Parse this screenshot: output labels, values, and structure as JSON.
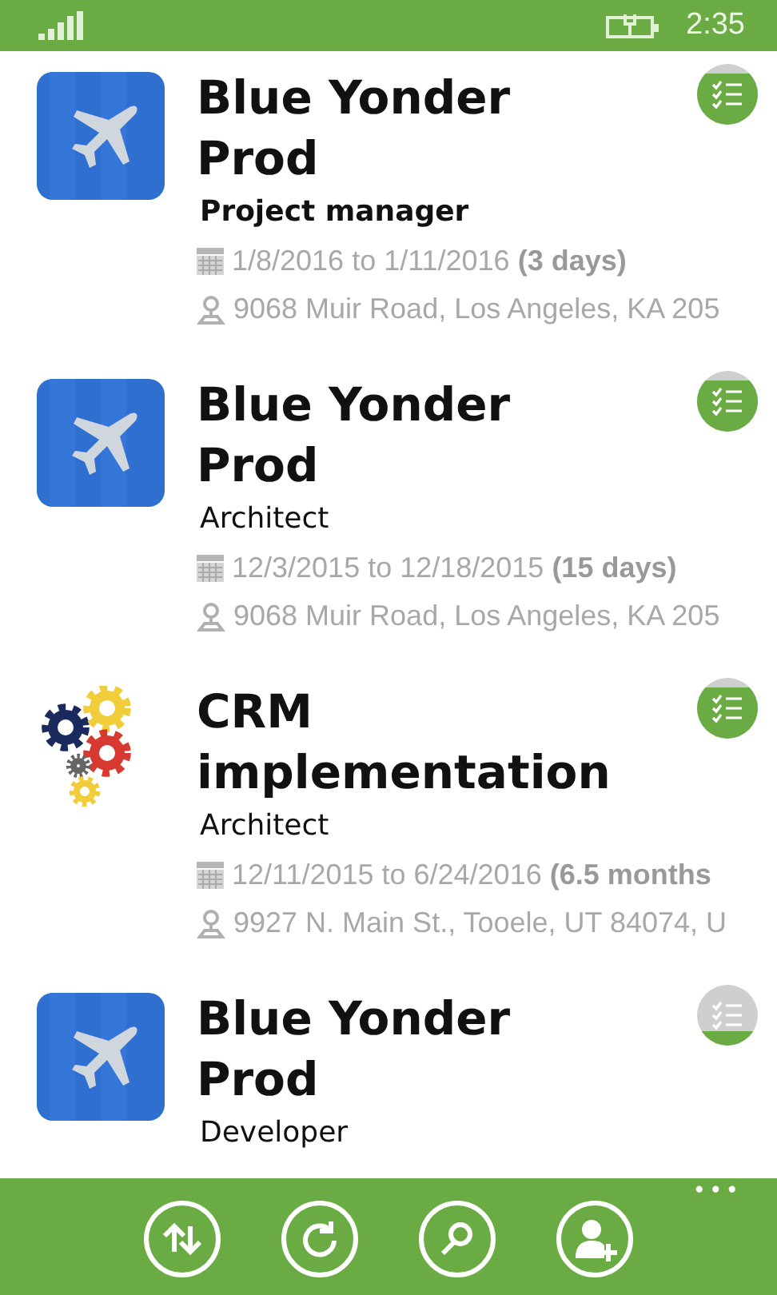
{
  "status_bar": {
    "time": "2:35"
  },
  "projects": [
    {
      "logo": {
        "kind": "plane"
      },
      "title": "Blue Yonder Prod",
      "role": "Project manager",
      "role_bold": true,
      "mostly_done": true,
      "dates": "1/8/2016 to 1/11/2016 **(3 days)**",
      "address": "9068 Muir Road, Los Angeles, KA 205"
    },
    {
      "logo": {
        "kind": "plane"
      },
      "title": "Blue Yonder Prod",
      "role": "Architect",
      "role_bold": false,
      "mostly_done": true,
      "dates": "12/3/2015 to 12/18/2015 **(15 days)**",
      "address": "9068 Muir Road, Los Angeles, KA 205"
    },
    {
      "logo": {
        "kind": "gears"
      },
      "title": "CRM implementation",
      "role": "Architect",
      "role_bold": false,
      "mostly_done": true,
      "dates": "12/11/2015 to 6/24/2016 **(6.5 months**",
      "address": "9927 N. Main St., Tooele, UT 84074, U"
    },
    {
      "logo": {
        "kind": "plane"
      },
      "title": "Blue Yonder Prod",
      "role": "Developer",
      "role_bold": false,
      "mostly_done": false
    }
  ],
  "app_bar": {
    "buttons": [
      {
        "kind": "sort"
      },
      {
        "kind": "refresh"
      },
      {
        "kind": "search"
      },
      {
        "kind": "add-contact"
      }
    ],
    "more": "•••"
  }
}
